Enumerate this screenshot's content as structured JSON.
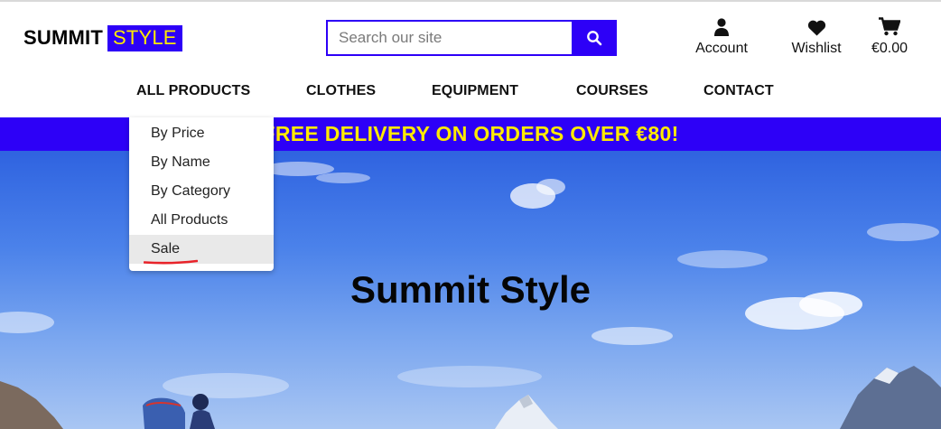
{
  "logo": {
    "part1": "SUMMIT",
    "part2": "STYLE"
  },
  "search": {
    "placeholder": "Search our site",
    "value": "",
    "button_icon": "search-icon"
  },
  "header_links": [
    {
      "label": "Account",
      "icon": "user-icon"
    },
    {
      "label": "Wishlist",
      "icon": "heart-icon"
    },
    {
      "label": "€0.00",
      "icon": "cart-icon"
    }
  ],
  "nav": [
    "ALL PRODUCTS",
    "CLOTHES",
    "EQUIPMENT",
    "COURSES",
    "CONTACT"
  ],
  "dropdown": {
    "items": [
      "By Price",
      "By Name",
      "By Category",
      "All Products",
      "Sale"
    ],
    "highlighted": "Sale"
  },
  "banner": {
    "text": "FREE DELIVERY ON ORDERS OVER €80!"
  },
  "hero": {
    "title": "Summit Style"
  },
  "colors": {
    "brand": "#2d00f7",
    "accent": "#ffea00",
    "annotation": "#e8232a"
  }
}
